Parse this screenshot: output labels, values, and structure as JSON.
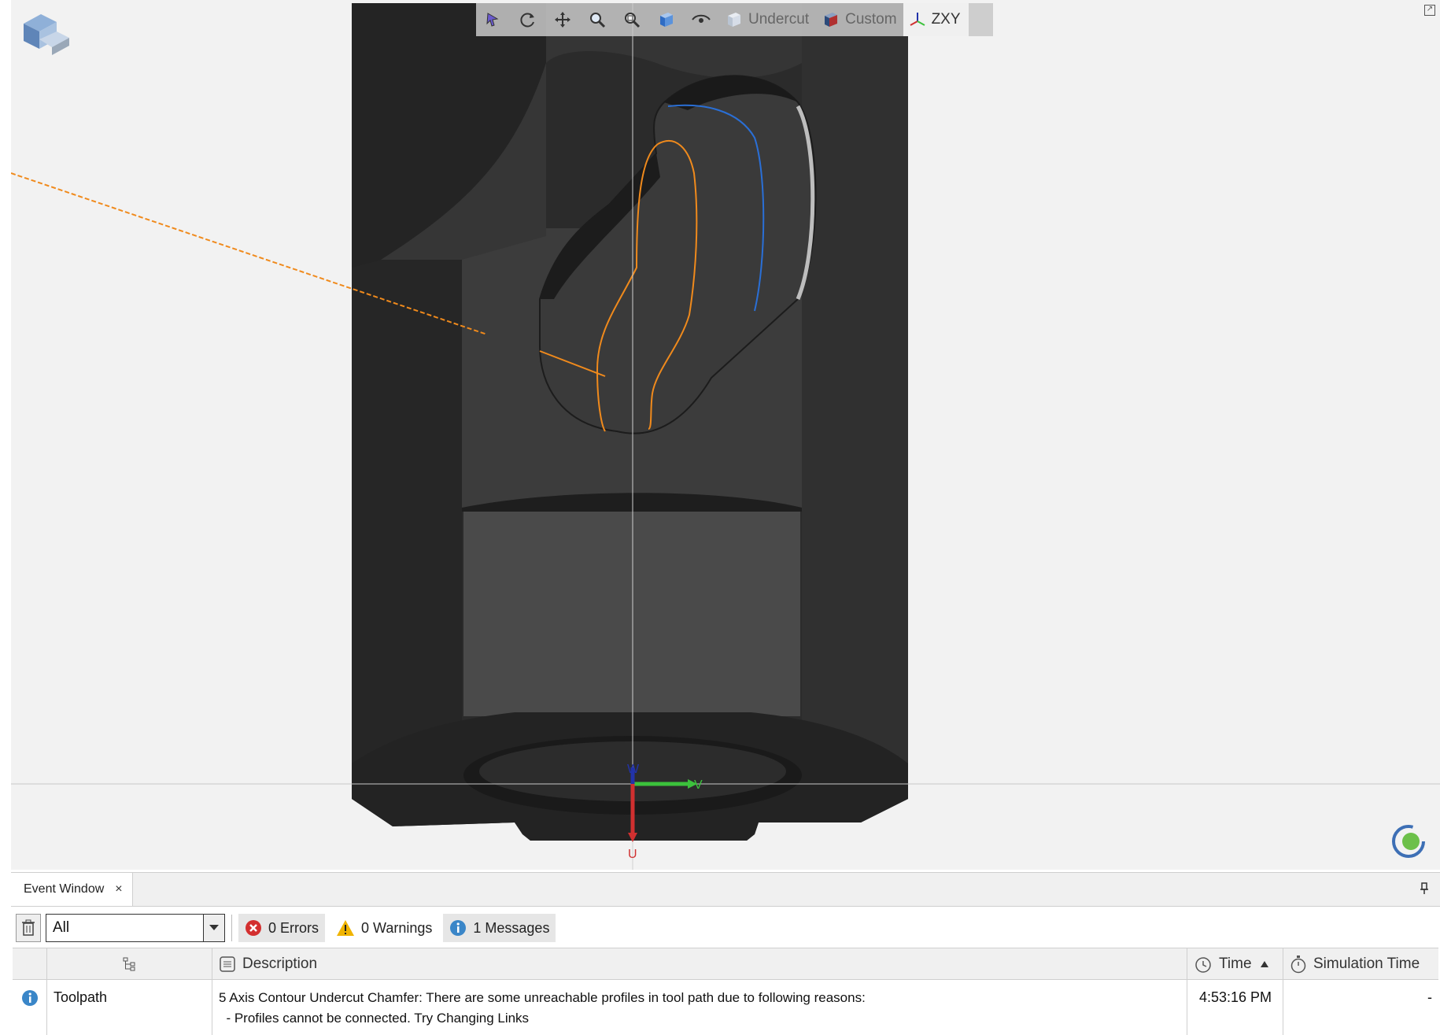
{
  "viewport": {
    "toolbar": {
      "buttons": [
        {
          "name": "select",
          "icon": "select-icon"
        },
        {
          "name": "rotate",
          "icon": "rotate-icon"
        },
        {
          "name": "pan",
          "icon": "pan-icon"
        },
        {
          "name": "zoom-window",
          "icon": "zoom-window-icon"
        },
        {
          "name": "zoom-fit",
          "icon": "zoom-fit-icon"
        },
        {
          "name": "view-cube",
          "icon": "view-cube-icon"
        },
        {
          "name": "visibility",
          "icon": "eye-icon"
        }
      ],
      "undercut_label": "Undercut",
      "custom_label": "Custom",
      "zxy_label": "ZXY"
    },
    "axes": {
      "w": "W",
      "v": "V",
      "u": "U"
    },
    "colors": {
      "model": "#333333",
      "toolpath": "#f08a1c",
      "background": "#f2f2f2"
    }
  },
  "event_window": {
    "tab_label": "Event Window",
    "filter_value": "All",
    "errors_label": "0 Errors",
    "warnings_label": "0 Warnings",
    "messages_label": "1 Messages",
    "columns": {
      "description": "Description",
      "time": "Time",
      "simulation_time": "Simulation Time"
    },
    "rows": [
      {
        "source": "Toolpath",
        "description_line1": "5 Axis Contour Undercut Chamfer: There are some unreachable profiles in tool path due to following reasons:",
        "description_line2": "  - Profiles cannot be connected. Try Changing Links",
        "time": "4:53:16 PM",
        "simulation_time": "-"
      }
    ]
  }
}
